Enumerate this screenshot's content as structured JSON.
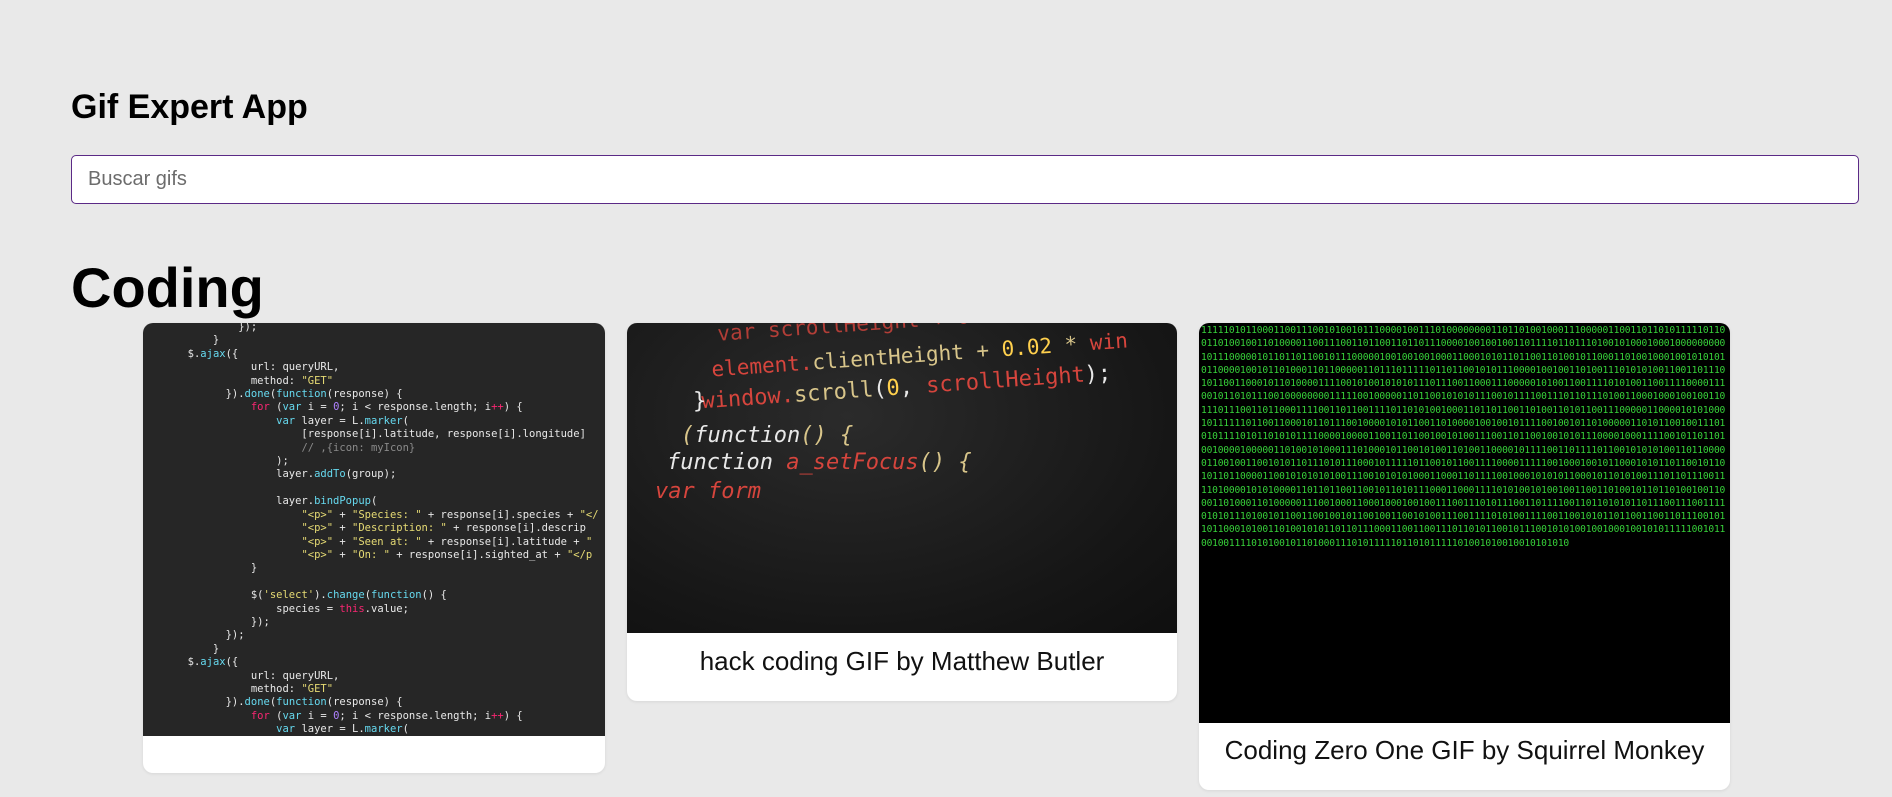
{
  "app": {
    "title": "Gif Expert App"
  },
  "search": {
    "placeholder": "Buscar gifs",
    "value": ""
  },
  "category": {
    "title": "Coding"
  },
  "gifs": [
    {
      "caption": ""
    },
    {
      "caption": "hack coding GIF by Matthew Butler"
    },
    {
      "caption": "Coding Zero One GIF by Squirrel Monkey"
    }
  ],
  "colors": {
    "background": "#e9e9e9",
    "search_border": "#5b2a86",
    "matrix_green": "#37d13a"
  }
}
